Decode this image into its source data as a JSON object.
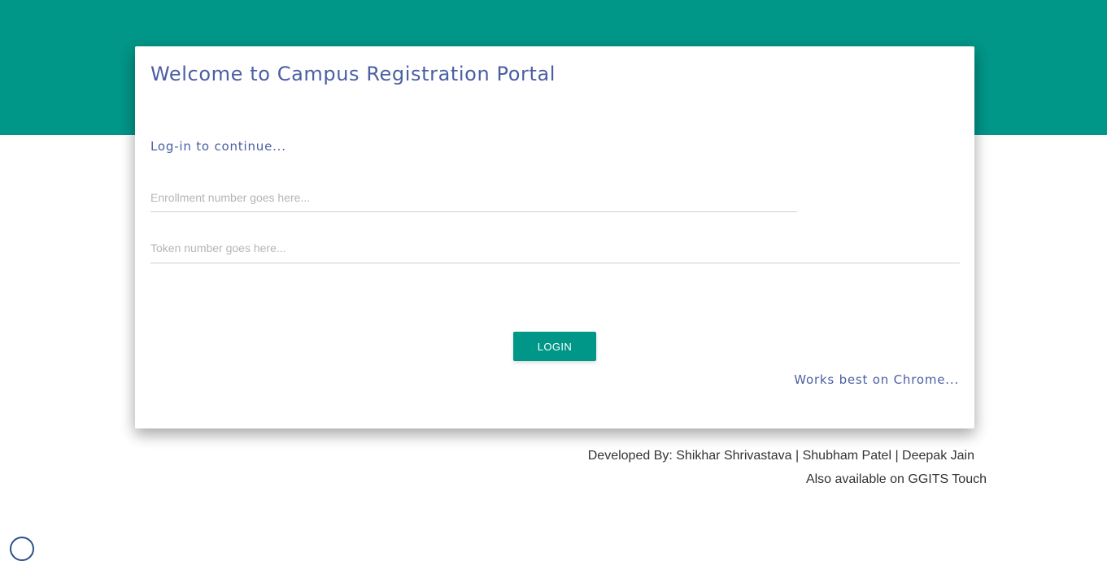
{
  "header": {
    "background_color": "#009688"
  },
  "card": {
    "title": "Welcome to Campus Registration Portal",
    "subtitle": "Log-in to continue...",
    "enrollment_field": {
      "value": "",
      "placeholder": "Enrollment number goes here..."
    },
    "token_field": {
      "value": "",
      "placeholder": "Token number goes here..."
    },
    "login_label": "LOGIN",
    "browser_note": "Works best on Chrome..."
  },
  "footer": {
    "credits": "Developed By: Shikhar Shrivastava | Shubham Patel | Deepak Jain",
    "availability": "Also available on GGITS Touch"
  },
  "colors": {
    "accent": "#009688",
    "heading": "#4a5fa3",
    "footer_text": "#333333"
  }
}
